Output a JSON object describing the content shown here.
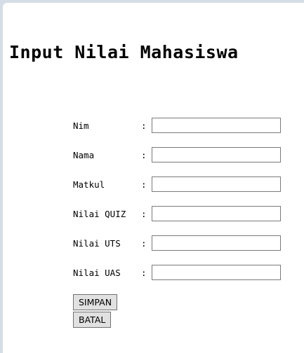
{
  "title": "Input Nilai Mahasiswa",
  "fields": [
    {
      "label": "Nim",
      "separator": ":",
      "value": ""
    },
    {
      "label": "Nama",
      "separator": ":",
      "value": ""
    },
    {
      "label": "Matkul",
      "separator": ":",
      "value": ""
    },
    {
      "label": "Nilai QUIZ",
      "separator": ":",
      "value": ""
    },
    {
      "label": "Nilai UTS",
      "separator": ":",
      "value": ""
    },
    {
      "label": "Nilai UAS",
      "separator": ":",
      "value": ""
    }
  ],
  "buttons": {
    "save_label": "SIMPAN",
    "cancel_label": "BATAL"
  }
}
